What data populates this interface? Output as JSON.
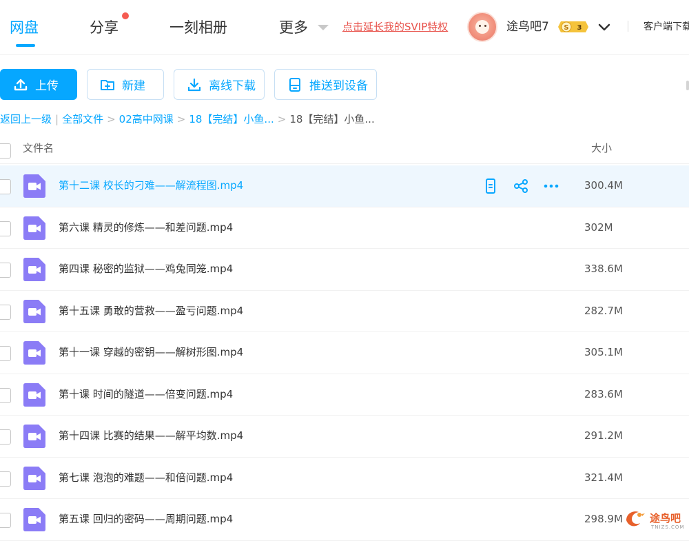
{
  "nav": {
    "tabs": [
      {
        "label": "网盘",
        "active": true
      },
      {
        "label": "分享",
        "has_dot": true
      },
      {
        "label": "一刻相册"
      },
      {
        "label": "更多"
      }
    ],
    "svip_link": "点击延长我的SVIP特权",
    "username": "途鸟吧7",
    "vip_badge": {
      "symbol": "S",
      "level": "3"
    },
    "client_link": "客户端下载"
  },
  "toolbar": {
    "upload": "上传",
    "new": "新建",
    "offline": "离线下载",
    "push": "推送到设备"
  },
  "breadcrumb": {
    "back": "返回上一级",
    "items": [
      "全部文件",
      "02高中网课",
      "18【完结】小鱼..."
    ],
    "current": "18【完结】小鱼..."
  },
  "table": {
    "col_name": "文件名",
    "col_size": "大小",
    "rows": [
      {
        "name": "第十二课 校长的刁难——解流程图.mp4",
        "size": "300.4M",
        "hover": true
      },
      {
        "name": "第六课 精灵的修炼——和差问题.mp4",
        "size": "302M"
      },
      {
        "name": "第四课 秘密的监狱——鸡兔同笼.mp4",
        "size": "338.6M"
      },
      {
        "name": "第十五课 勇敢的营救——盈亏问题.mp4",
        "size": "282.7M"
      },
      {
        "name": "第十一课 穿越的密钥——解树形图.mp4",
        "size": "305.1M"
      },
      {
        "name": "第十课 时间的隧道——倍变问题.mp4",
        "size": "283.6M"
      },
      {
        "name": "第十四课 比赛的结果——解平均数.mp4",
        "size": "291.2M"
      },
      {
        "name": "第七课 泡泡的难题——和倍问题.mp4",
        "size": "321.4M"
      },
      {
        "name": "第五课 回归的密码——周期问题.mp4",
        "size": "298.9M"
      }
    ]
  },
  "watermark": {
    "text": "途鸟吧",
    "sub": "TNIZS.COM"
  },
  "colors": {
    "accent": "#06a7ff",
    "video_icon": "#8b7cf6",
    "svip": "#e8524b",
    "badge": "#f5c33b"
  }
}
